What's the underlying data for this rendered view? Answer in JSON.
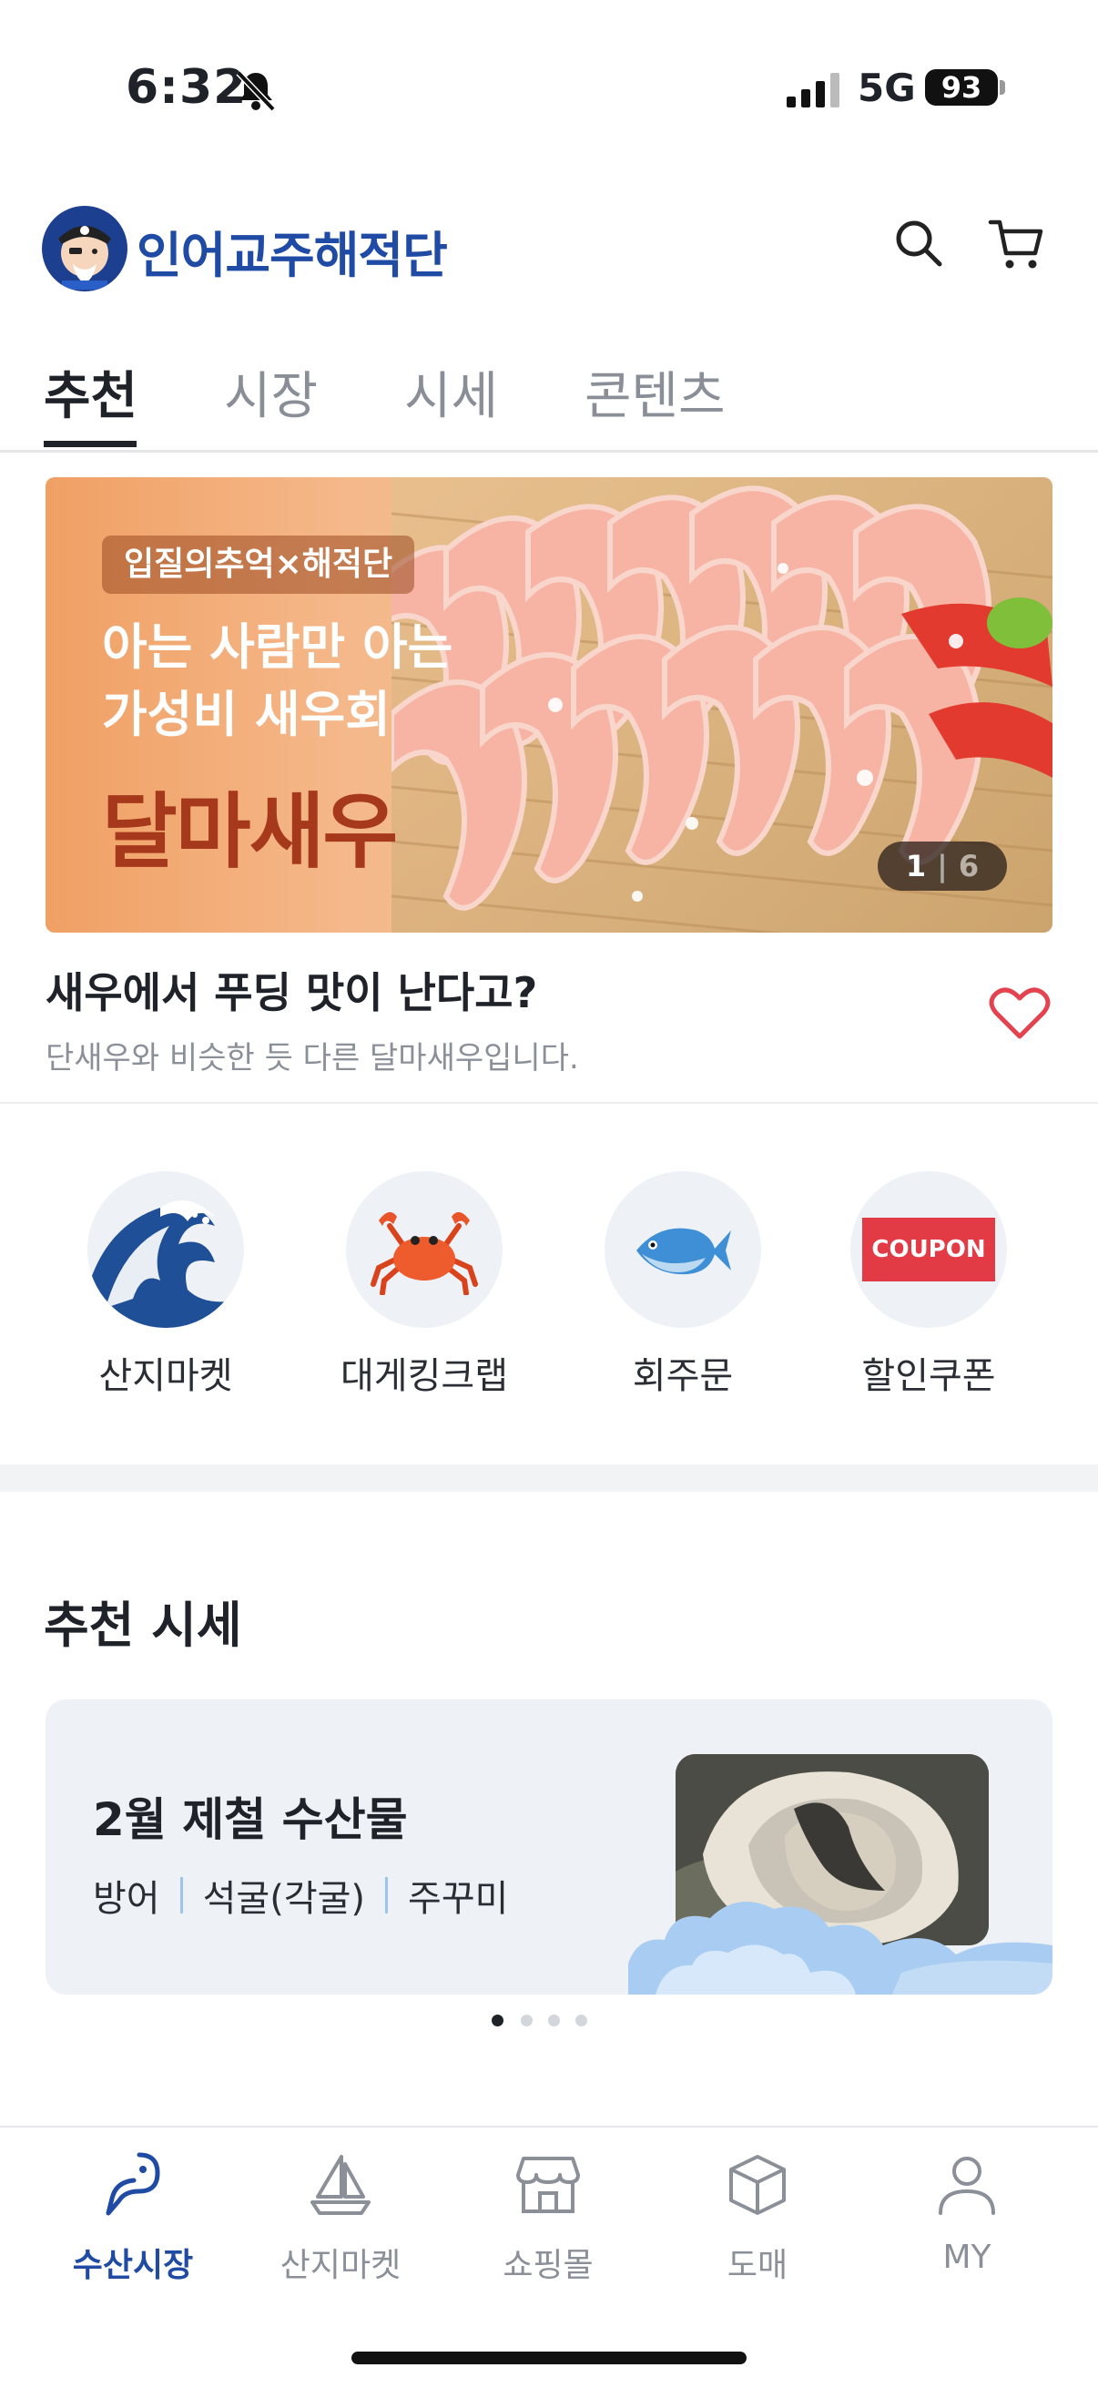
{
  "status_bar": {
    "time": "6:32",
    "network": "5G",
    "battery": "93"
  },
  "header": {
    "brand_name": "인어교주해적단"
  },
  "tabs": [
    {
      "label": "추천",
      "active": true
    },
    {
      "label": "시장"
    },
    {
      "label": "시세"
    },
    {
      "label": "콘텐츠"
    }
  ],
  "banner": {
    "tag": "입질의추억×해적단",
    "headline_line1": "아는 사람만 아는",
    "headline_line2": "가성비 새우회",
    "product": "달마새우",
    "page_current": "1",
    "page_total": "6",
    "title": "새우에서 푸딩 맛이 난다고?",
    "description": "단새우와 비슷한 듯 다른 달마새우입니다."
  },
  "quick_menu": [
    {
      "label": "산지마켓",
      "icon": "wave-icon"
    },
    {
      "label": "대게킹크랩",
      "icon": "crab-icon"
    },
    {
      "label": "회주문",
      "icon": "fish-icon"
    },
    {
      "label": "할인쿠폰",
      "icon": "coupon-icon",
      "badge": "COUPON"
    }
  ],
  "price_section": {
    "title": "추천 시세",
    "card_title": "2월 제철 수산물",
    "items": [
      "방어",
      "석굴(각굴)",
      "주꾸미"
    ]
  },
  "bottom_nav": [
    {
      "label": "수산시장",
      "icon": "fish-hook-icon",
      "active": true
    },
    {
      "label": "산지마켓",
      "icon": "sailboat-icon"
    },
    {
      "label": "쇼핑몰",
      "icon": "store-icon"
    },
    {
      "label": "도매",
      "icon": "box-icon"
    },
    {
      "label": "MY",
      "icon": "person-icon"
    }
  ],
  "colors": {
    "brand": "#1f4ba5",
    "heart": "#e5424f",
    "coupon": "#e23b45"
  }
}
